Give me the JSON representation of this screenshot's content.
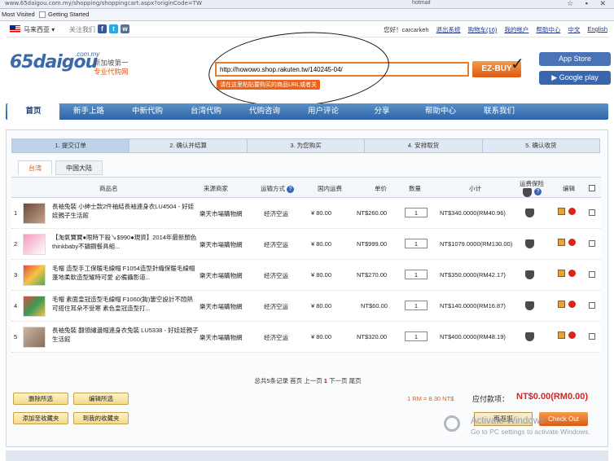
{
  "browser": {
    "url": "www.65daigou.com.my/shopping/shoppingcart.aspx?originCode=TW",
    "search_field": "hotmail",
    "bookmarks": [
      "Most Visited",
      "Getting Started"
    ]
  },
  "site": {
    "country": "马来西亚",
    "follow_label": "关注我们",
    "social_icons": [
      "facebook-icon",
      "twitter-icon",
      "weibo-icon"
    ],
    "top_links": [
      "您好！carcarkeh",
      "退出系统",
      "购物车(16)",
      "我的帐户",
      "帮助中心",
      "中文",
      "English"
    ]
  },
  "header": {
    "logo_main": "65daigou",
    "logo_com": ".com.my",
    "tagline_1": "新加坡第一",
    "tagline_2": "专业代购网",
    "url_input_value": "http://howowo.shop.rakuten.tw/140245-04/",
    "ezbuy_label": "EZ-BUY",
    "hint": "请在这里粘贴要购买的商品URL或者关",
    "app_store": "App Store",
    "google_play": "Google play"
  },
  "nav": [
    "首页",
    "新手上路",
    "中新代购",
    "台湾代购",
    "代购咨询",
    "用户评论",
    "分享",
    "帮助中心",
    "联系我们"
  ],
  "steps": [
    "1. 提交订单",
    "2. 确认并结算",
    "3. 为您购买",
    "4. 安排取货",
    "5. 确认收货"
  ],
  "tabs": [
    "台湾",
    "中国大陆"
  ],
  "table": {
    "headers": [
      "商品名",
      "来源商家",
      "运输方式",
      "国内运费",
      "单价",
      "数量",
      "小计",
      "运费保险",
      "编辑"
    ],
    "rows": [
      {
        "idx": "1",
        "name": "長袖兔裝 小紳士款2件袖結長袖連身衣LU4504 - 好娃娃親子生活館",
        "seller": "樂天市場購物網",
        "shipping": "经济空运",
        "domestic": "¥ 80.00",
        "price": "NT$260.00",
        "qty": "1",
        "subtotal": "NT$340.0000(RM40.96)"
      },
      {
        "idx": "2",
        "name": "【淘氣寶寶●限時下殺↘$990●現貨】2014年最新顏色 thinkbaby不鏽鋼餐具組...",
        "seller": "樂天市場購物網",
        "shipping": "经济空运",
        "domestic": "¥ 80.00",
        "price": "NT$999.00",
        "qty": "1",
        "subtotal": "NT$1079.0000(RM130.00)"
      },
      {
        "idx": "3",
        "name": "毛帽 造型手工保暖毛線帽 F1054造型針織保暖毛線帽 蓬地柔軟造型耀時可愛 必備攝影道...",
        "seller": "樂天市場購物網",
        "shipping": "经济空运",
        "domestic": "¥ 80.00",
        "price": "NT$270.00",
        "qty": "1",
        "subtotal": "NT$350.0000(RM42.17)"
      },
      {
        "idx": "4",
        "name": "毛帽 素面皇冠造型毛線帽 F1060(鉤)簍空設計不悶熱 可搭住耳朵不受寒 素色皇冠造型打...",
        "seller": "樂天市場購物網",
        "shipping": "经济空运",
        "domestic": "¥ 80.00",
        "price": "NT$60.00",
        "qty": "1",
        "subtotal": "NT$140.0000(RM16.87)"
      },
      {
        "idx": "5",
        "name": "長袖兔裝 翻領繡邊帽連身衣兔裝 LU5338 - 好娃娃親子生活館",
        "seller": "樂天市場購物網",
        "shipping": "经济空运",
        "domestic": "¥ 80.00",
        "price": "NT$320.00",
        "qty": "1",
        "subtotal": "NT$400.0000(RM48.19)"
      }
    ]
  },
  "pager": {
    "prefix": "总共5条记录",
    "first": "首页",
    "prev": "上一页",
    "current": "1",
    "next": "下一页",
    "last": "尾页"
  },
  "actions": {
    "delete_selected": "删除所选",
    "edit_selected": "编辑所选",
    "add_to_favorites": "添加至收藏夹",
    "go_to_favorites": "到我的收藏夹",
    "redo": "再逛逛",
    "checkout": "Check Out"
  },
  "summary": {
    "rate": "1 RM = 8.30 NT$",
    "payable_label": "应付款项：",
    "total": "NT$0.00(RM0.00)"
  },
  "watermark": {
    "line1": "Activate Windows",
    "line2": "Go to PC settings to activate Windows."
  },
  "colors": {
    "brand_blue": "#2d65a6",
    "accent_orange": "#e05a1b",
    "total_red": "#e0201b"
  }
}
